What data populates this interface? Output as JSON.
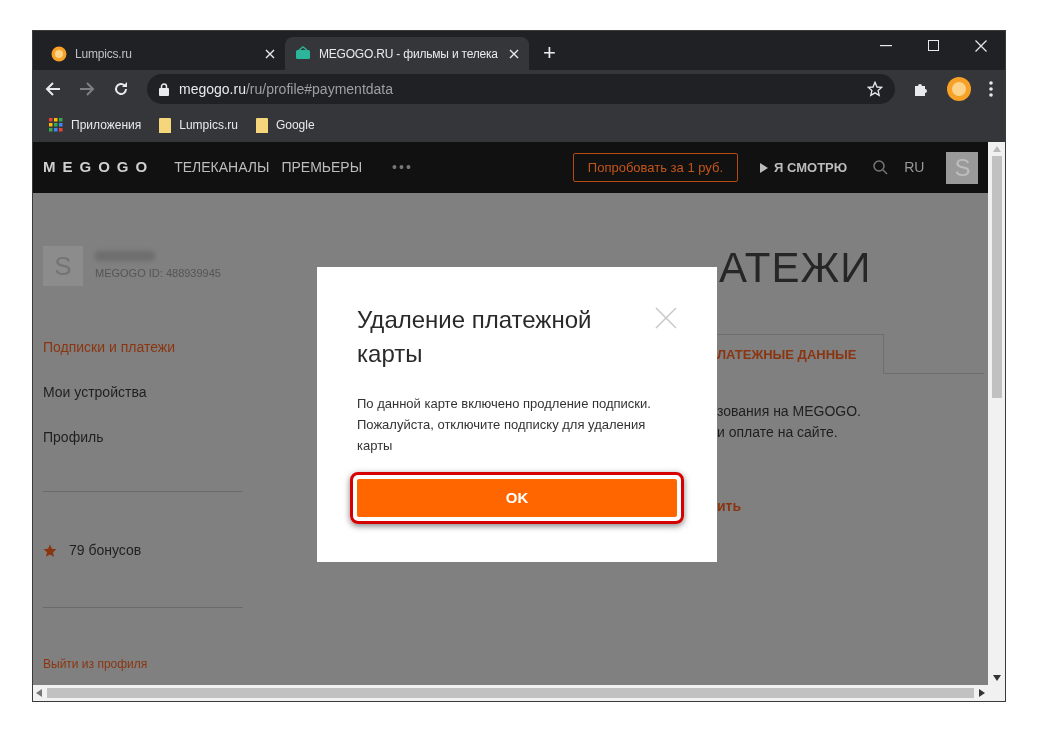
{
  "browser": {
    "tabs": [
      {
        "title": "Lumpics.ru",
        "selected": false,
        "kind": "orange"
      },
      {
        "title": "MEGOGO.RU - фильмы и телека",
        "selected": true,
        "kind": "megogo"
      }
    ],
    "new_tab": "+",
    "address": {
      "domain": "megogo.ru",
      "path": "/ru/profile#paymentdata"
    },
    "bookmarks": [
      {
        "label": "Приложения",
        "kind": "apps"
      },
      {
        "label": "Lumpics.ru",
        "kind": "folder"
      },
      {
        "label": "Google",
        "kind": "folder"
      }
    ]
  },
  "site_header": {
    "logo": "MEGOGO",
    "nav": [
      "ТЕЛЕКАНАЛЫ",
      "ПРЕМЬЕРЫ"
    ],
    "more": "•••",
    "try_button": "Попробовать за 1 руб.",
    "watching": "Я СМОТРЮ",
    "language": "RU",
    "avatar_letter": "S"
  },
  "sidebar": {
    "avatar_letter": "S",
    "user_id": "MEGOGO ID: 488939945",
    "menu": [
      {
        "label": "Подписки и платежи",
        "selected": true
      },
      {
        "label": "Мои устройства",
        "selected": false
      },
      {
        "label": "Профиль",
        "selected": false
      }
    ],
    "bonuses": "79 бонусов",
    "logout": "Выйти из профиля"
  },
  "page": {
    "heading": "АТЕЖИ",
    "tab_fragment": "ЛАТЕЖНЫЕ ДАННЫЕ",
    "text_fragments": [
      "зования на MEGOGO.",
      "и оплате на сайте."
    ],
    "link_fragment": "ить"
  },
  "dialog": {
    "title": "Удаление платежной карты",
    "message": "По данной карте включено продление подписки. Пожалуйста, отключите подписку для удаления карты",
    "ok": "OK",
    "highlighted": true
  }
}
